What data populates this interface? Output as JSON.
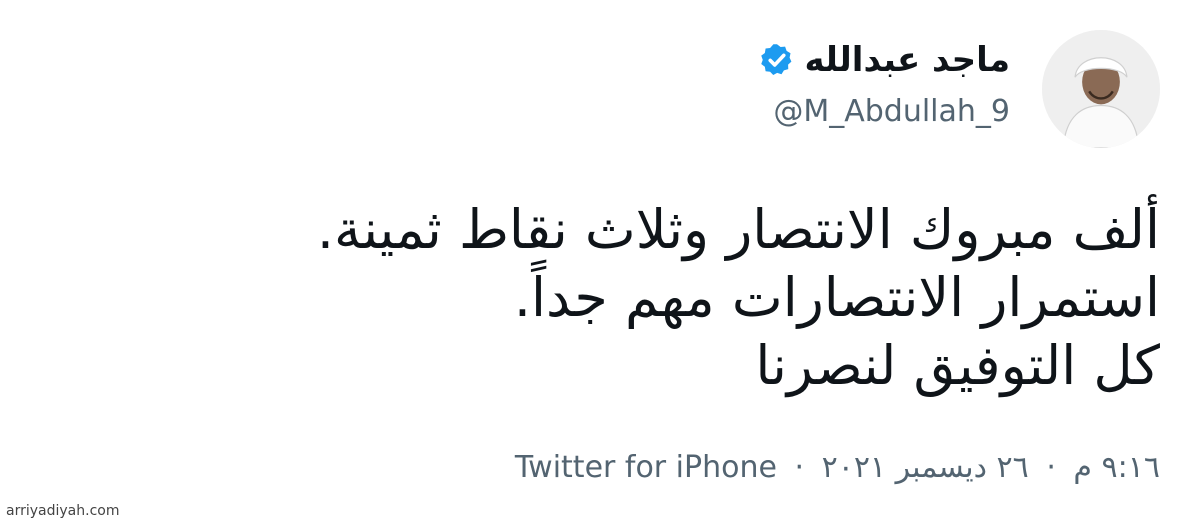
{
  "user": {
    "display_name": "ماجد عبدالله",
    "handle": "@M_Abdullah_9",
    "verified": true,
    "avatar_icon": "avatar-photo"
  },
  "tweet": {
    "lines": [
      "ألف مبروك الانتصار وثلاث نقاط ثمينة.",
      "استمرار الانتصارات مهم جداً.",
      "كل التوفيق لنصرنا"
    ]
  },
  "meta": {
    "time": "٩:١٦ م",
    "date": "٢٦ ديسمبر ٢٠٢١",
    "separator": "·",
    "source": "Twitter for iPhone"
  },
  "watermark": {
    "text": "arriyadiyah.com"
  },
  "colors": {
    "verified": "#1d9bf0",
    "text": "#0f1419",
    "secondary": "#536471"
  }
}
